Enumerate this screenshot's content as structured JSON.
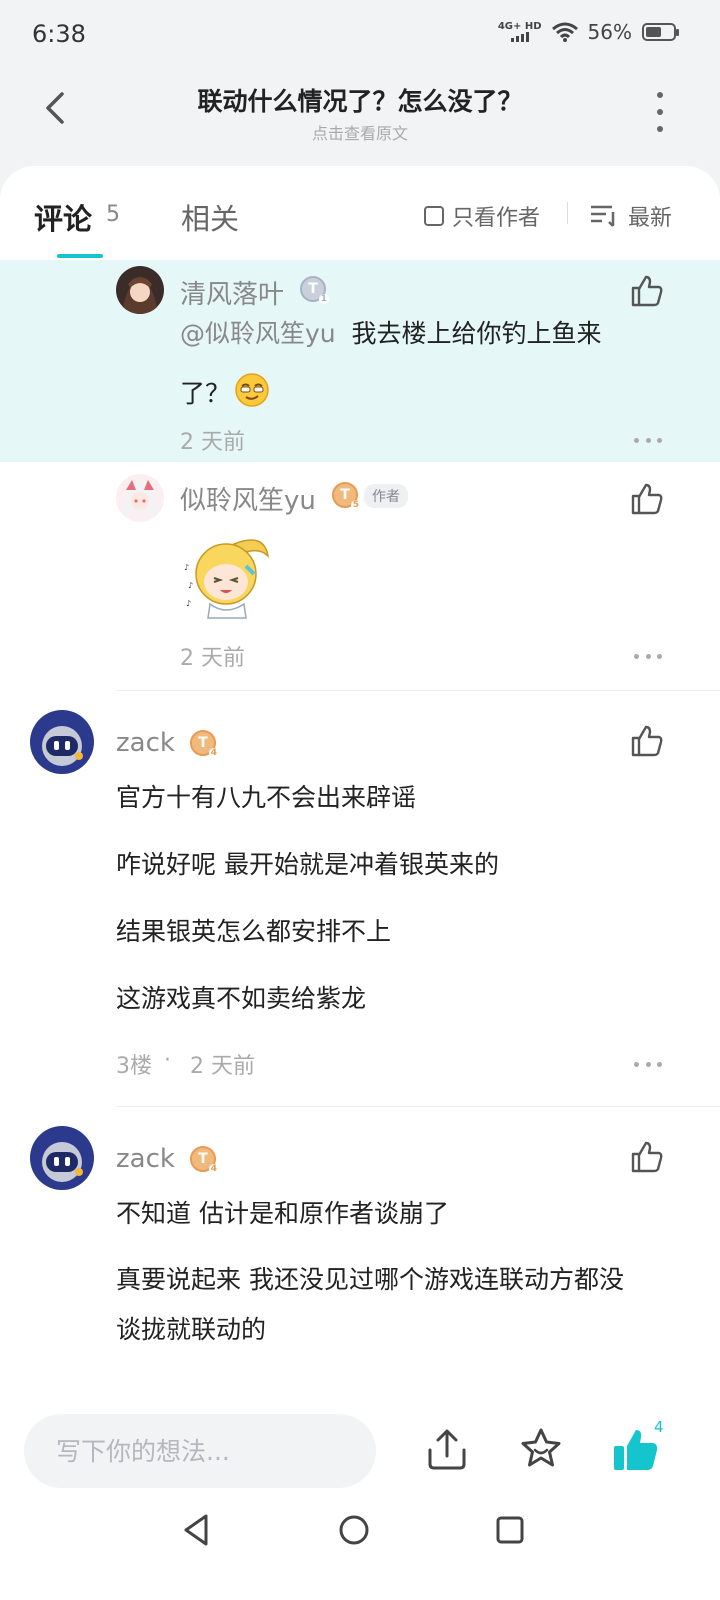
{
  "status": {
    "time": "6:38",
    "network": "4G+ HD",
    "battery": "56%",
    "battery_level": 0.56
  },
  "header": {
    "title": "联动什么情况了？怎么没了？",
    "subtitle": "点击查看原文"
  },
  "tabs": {
    "comments_label": "评论",
    "comments_count": "5",
    "related_label": "相关",
    "author_only_label": "只看作者",
    "sort_label": "最新"
  },
  "replies": [
    {
      "username": "清风落叶",
      "level": "1",
      "mention": "@似聆风笙yu",
      "text_line1": "我去楼上给你钓上鱼来",
      "text_line2": "了？",
      "time": "2 天前"
    },
    {
      "username": "似聆风笙yu",
      "level": "5",
      "tag": "作者",
      "time": "2 天前"
    }
  ],
  "comments": [
    {
      "username": "zack",
      "level": "4",
      "lines": [
        "官方十有八九不会出来辟谣",
        "咋说好呢 最开始就是冲着银英来的",
        "结果银英怎么都安排不上",
        "这游戏真不如卖给紫龙"
      ],
      "floor": "3楼",
      "dot": "·",
      "time": "2 天前"
    },
    {
      "username": "zack",
      "level": "4",
      "lines": [
        "不知道 估计是和原作者谈崩了",
        "真要说起来 我还没见过哪个游戏连联动方都没",
        "谈拢就联动的"
      ]
    }
  ],
  "bottom": {
    "input_placeholder": "写下你的想法...",
    "like_count": "4"
  },
  "colors": {
    "accent": "#15c5ce",
    "highlight": "#e6f7f8",
    "badge_gold": "#f1b97c",
    "badge_silver": "#c9cfdb"
  }
}
